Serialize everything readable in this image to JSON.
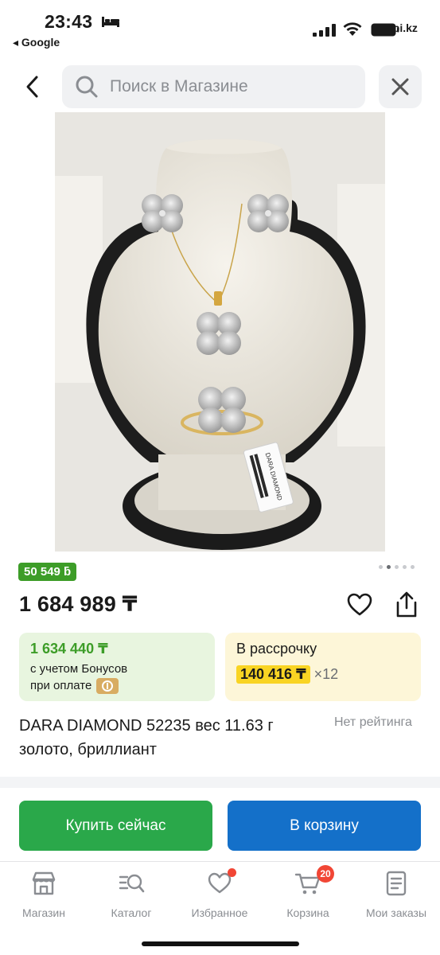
{
  "status_bar": {
    "time": "23:43",
    "back_app": "◂ Google",
    "site": "spi.kz"
  },
  "search": {
    "placeholder": "Поиск в Магазине"
  },
  "product": {
    "bonus_badge": "50 549 ƃ",
    "price": "1 684 989 ₸",
    "title": "DARA DIAMOND 52235 вес 11.63 г золото, бриллиант",
    "rating": "Нет рейтинга",
    "photo_tag_text": "DARA DIAMOND",
    "photo_gallery": {
      "total": 5,
      "active_index": 1
    }
  },
  "bonus_card": {
    "value": "1 634 440 ₸",
    "line1": "с учетом Бонусов",
    "line2": "при оплате"
  },
  "credit_card": {
    "title": "В рассрочку",
    "monthly": "140 416 ₸",
    "multiplier": "×12"
  },
  "actions": {
    "buy_now": "Купить сейчас",
    "add_to_cart": "В корзину"
  },
  "bottom_nav": {
    "items": [
      {
        "label": "Магазин",
        "icon": "shop-icon"
      },
      {
        "label": "Каталог",
        "icon": "catalog-search-icon"
      },
      {
        "label": "Избранное",
        "icon": "heart-icon"
      },
      {
        "label": "Корзина",
        "icon": "cart-icon",
        "badge": "20"
      },
      {
        "label": "Мои заказы",
        "icon": "orders-icon"
      }
    ]
  },
  "colors": {
    "green": "#3d9d28",
    "buy_green": "#2aa84a",
    "cart_blue": "#1470c9",
    "yellow": "#f9d423",
    "badge_red": "#f14635"
  }
}
